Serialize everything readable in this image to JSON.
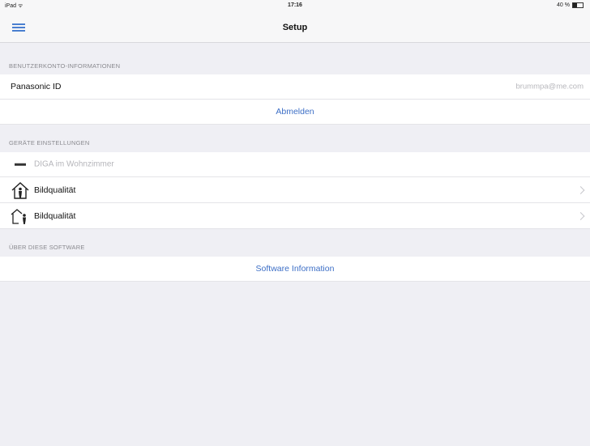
{
  "status_bar": {
    "carrier": "iPad ᯤ",
    "time": "17:16",
    "battery_text": "40 %",
    "battery_level": 0.4
  },
  "nav": {
    "title": "Setup",
    "menu_icon": "hamburger-menu-icon"
  },
  "sections": {
    "account": {
      "header": "BENUTZERKONTO-INFORMATIONEN",
      "id_label": "Panasonic ID",
      "id_value": "brummpa@me.com",
      "logout_label": "Abmelden"
    },
    "device": {
      "header": "GERÄTE EINSTELLUNGEN",
      "device_name": "DIGA im Wohnzimmer",
      "items": [
        {
          "label": "Bildqualität",
          "icon": "home-inside-person-icon"
        },
        {
          "label": "Bildqualität",
          "icon": "home-outside-person-icon"
        }
      ]
    },
    "about": {
      "header": "ÜBER DIESE SOFTWARE",
      "info_label": "Software Information"
    }
  },
  "colors": {
    "accent": "#3d6fc6",
    "background": "#efeff4"
  }
}
